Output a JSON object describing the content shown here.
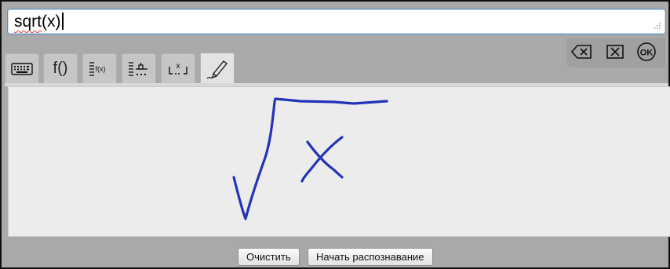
{
  "input": {
    "value_underlined": "sqrt",
    "value_rest": "(x)"
  },
  "tabs": [
    {
      "name": "keyboard",
      "icon": "keyboard-icon"
    },
    {
      "name": "functions",
      "label": "f()"
    },
    {
      "name": "function-list",
      "icon": "function-list-icon",
      "label": "f(x)"
    },
    {
      "name": "variable-list",
      "icon": "variable-list-icon"
    },
    {
      "name": "placeholder",
      "icon": "placeholder-icon",
      "label": "x"
    },
    {
      "name": "handwriting",
      "icon": "pen-icon",
      "active": true
    }
  ],
  "actions": {
    "backspace": "backspace-icon",
    "clear": "clear-icon",
    "ok_label": "OK"
  },
  "canvas": {
    "stroke_color": "#2233b8"
  },
  "buttons": {
    "clear_label": "Очистить",
    "recognize_label": "Начать распознавание"
  }
}
